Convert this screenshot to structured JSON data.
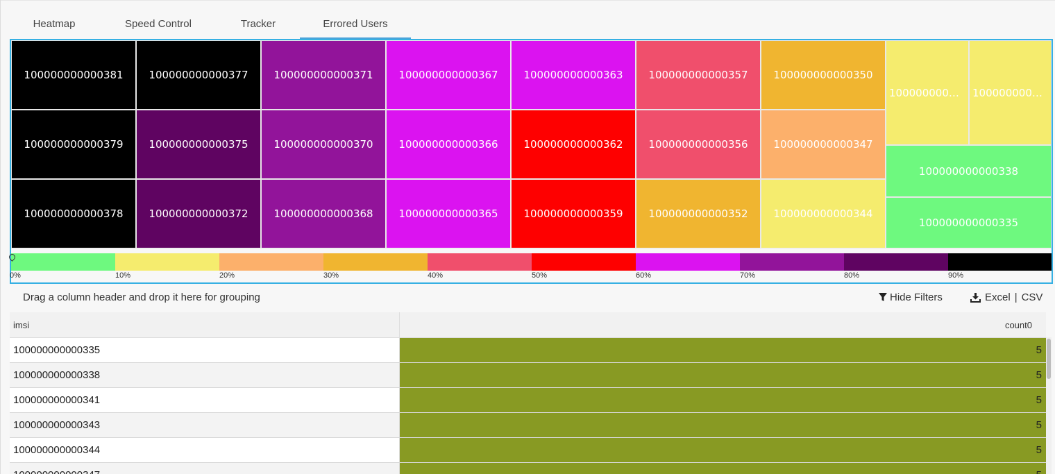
{
  "tabs": [
    {
      "label": "Heatmap",
      "active": false
    },
    {
      "label": "Speed Control",
      "active": false
    },
    {
      "label": "Tracker",
      "active": false
    },
    {
      "label": "Errored Users",
      "active": true
    }
  ],
  "heatmap": {
    "cells": [
      {
        "id": "100000000000381",
        "color": "#000000"
      },
      {
        "id": "100000000000377",
        "color": "#000000"
      },
      {
        "id": "100000000000371",
        "color": "#92149a"
      },
      {
        "id": "100000000000367",
        "color": "#db13f0"
      },
      {
        "id": "100000000000363",
        "color": "#db13f0"
      },
      {
        "id": "100000000000357",
        "color": "#f04f6c"
      },
      {
        "id": "100000000000350",
        "color": "#f0b530"
      },
      {
        "id": "100000000000379",
        "color": "#000000"
      },
      {
        "id": "100000000000375",
        "color": "#5f0461"
      },
      {
        "id": "100000000000370",
        "color": "#92149a"
      },
      {
        "id": "100000000000366",
        "color": "#db13f0"
      },
      {
        "id": "100000000000362",
        "color": "#fe0000"
      },
      {
        "id": "100000000000356",
        "color": "#f04f6c"
      },
      {
        "id": "100000000000347",
        "color": "#fcb06b"
      },
      {
        "id": "100000000000378",
        "color": "#000000"
      },
      {
        "id": "100000000000372",
        "color": "#5f0461"
      },
      {
        "id": "100000000000368",
        "color": "#92149a"
      },
      {
        "id": "100000000000365",
        "color": "#db13f0"
      },
      {
        "id": "100000000000359",
        "color": "#fe0000"
      },
      {
        "id": "100000000000352",
        "color": "#f0b530"
      },
      {
        "id": "100000000000344",
        "color": "#f5ec6e"
      },
      {
        "id": "100000000000...",
        "color": "#f5ec6e"
      },
      {
        "id": "100000000000...",
        "color": "#f5ec6e"
      },
      {
        "id": "100000000000338",
        "color": "#6ef97f"
      },
      {
        "id": "100000000000335",
        "color": "#6ef97f"
      }
    ],
    "legend": {
      "colors": [
        "#6ef97f",
        "#f5ec6e",
        "#fcb06b",
        "#f0b530",
        "#f04f6c",
        "#fe0000",
        "#db13f0",
        "#92149a",
        "#5f0461",
        "#000000"
      ],
      "ticks": [
        "0%",
        "10%",
        "20%",
        "30%",
        "40%",
        "50%",
        "60%",
        "70%",
        "80%",
        "90%"
      ]
    }
  },
  "toolbar": {
    "group_hint": "Drag a column header and drop it here for grouping",
    "hide_filters": "Hide Filters",
    "excel": "Excel",
    "separator": "|",
    "csv": "CSV"
  },
  "grid": {
    "columns": {
      "imsi": "imsi",
      "count": "count0"
    },
    "row_color": "#889a23",
    "rows": [
      {
        "imsi": "100000000000335",
        "count": "5"
      },
      {
        "imsi": "100000000000338",
        "count": "5"
      },
      {
        "imsi": "100000000000341",
        "count": "5"
      },
      {
        "imsi": "100000000000343",
        "count": "5"
      },
      {
        "imsi": "100000000000344",
        "count": "5"
      },
      {
        "imsi": "100000000000347",
        "count": "5"
      }
    ]
  }
}
